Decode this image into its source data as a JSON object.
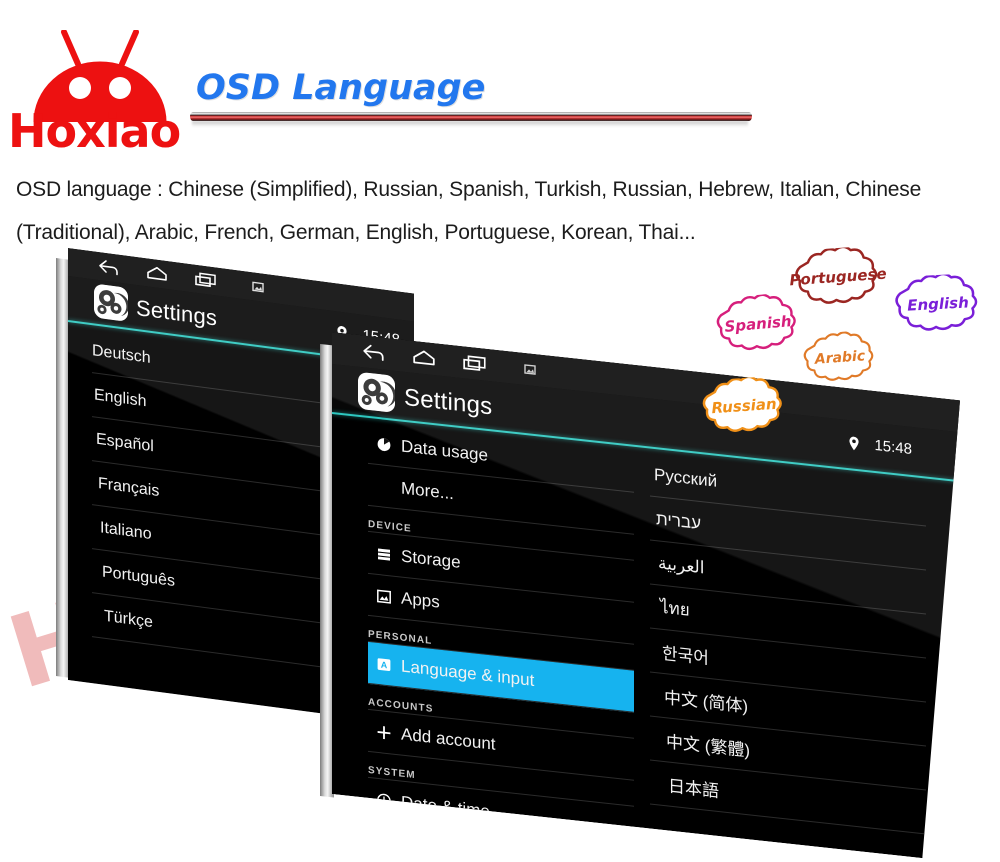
{
  "brand": {
    "name": "Hoxiao",
    "logo_icon": "android-robot-icon",
    "watermark": "Hoxiao"
  },
  "header": {
    "title": "OSD Language",
    "description": "OSD language : Chinese (Simplified), Russian, Spanish, Turkish, Russian, Hebrew, Italian, Chinese (Traditional), Arabic, French, German, English, Portuguese, Korean, Thai..."
  },
  "colors": {
    "title_blue": "#2277ee",
    "brand_red": "#ed1111",
    "accent_teal": "#2ec8c0",
    "selected_blue": "#16b3ef",
    "screen_black": "#000000"
  },
  "tablet_a": {
    "navbar": {
      "back": "back-icon",
      "home": "home-icon",
      "recents": "recents-icon",
      "screenshot": "screenshot-icon"
    },
    "app_title": "Settings",
    "app_icon": "settings-gear-icon",
    "status": {
      "location_icon": "location-pin-icon",
      "time": "15:48"
    },
    "languages": [
      "Deutsch",
      "English",
      "Español",
      "Français",
      "Italiano",
      "Português",
      "Türkçe"
    ]
  },
  "tablet_b": {
    "navbar": {
      "back": "back-icon",
      "home": "home-icon",
      "recents": "recents-icon",
      "screenshot": "screenshot-icon"
    },
    "app_title": "Settings",
    "app_icon": "settings-gear-icon",
    "status": {
      "location_icon": "location-pin-icon",
      "time": "15:48"
    },
    "settings_menu": [
      {
        "label": "Data usage",
        "icon": "pie-chart-icon",
        "type": "item",
        "selected": false
      },
      {
        "label": "More...",
        "icon": "",
        "type": "item",
        "selected": false
      },
      {
        "label": "DEVICE",
        "icon": "",
        "type": "header",
        "selected": false
      },
      {
        "label": "Storage",
        "icon": "storage-icon",
        "type": "item",
        "selected": false
      },
      {
        "label": "Apps",
        "icon": "apps-icon",
        "type": "item",
        "selected": false
      },
      {
        "label": "PERSONAL",
        "icon": "",
        "type": "header",
        "selected": false
      },
      {
        "label": "Language & input",
        "icon": "language-icon",
        "type": "item",
        "selected": true
      },
      {
        "label": "ACCOUNTS",
        "icon": "",
        "type": "header",
        "selected": false
      },
      {
        "label": "Add account",
        "icon": "plus-icon",
        "type": "item",
        "selected": false
      },
      {
        "label": "SYSTEM",
        "icon": "",
        "type": "header",
        "selected": false
      },
      {
        "label": "Date & time",
        "icon": "clock-icon",
        "type": "item",
        "selected": false
      }
    ],
    "languages": [
      "Русский",
      "עברית",
      "العربية",
      "ไทย",
      "한국어",
      "中文 (简体)",
      "中文 (繁體)",
      "日本語"
    ]
  },
  "bubbles": [
    {
      "label": "Portuguese",
      "color": "#9b2622"
    },
    {
      "label": "English",
      "color": "#7a1fd8"
    },
    {
      "label": "Spanish",
      "color": "#d61f7c"
    },
    {
      "label": "Arabic",
      "color": "#e07a28"
    },
    {
      "label": "Russian",
      "color": "#f09018"
    }
  ]
}
